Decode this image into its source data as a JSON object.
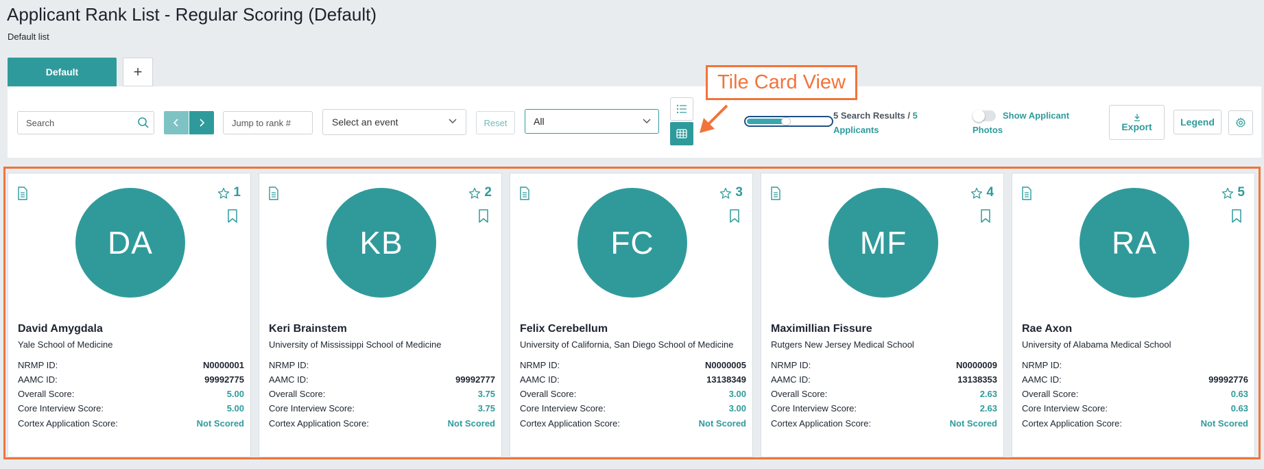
{
  "page": {
    "title": "Applicant Rank List - Regular Scoring (Default)",
    "subtitle": "Default list"
  },
  "tabs": [
    {
      "label": "Default",
      "active": true
    },
    {
      "label": "+",
      "active": false
    }
  ],
  "toolbar": {
    "search_placeholder": "Search",
    "jump_placeholder": "Jump to rank #",
    "event_select": "Select an event",
    "reset_label": "Reset",
    "filter_select": "All",
    "results_count": "5 Search Results /",
    "results_total": "5 Applicants",
    "slider_value": 0.48,
    "show_photos_label": "Show Applicant Photos",
    "show_photos_on": false,
    "export_label": "Export",
    "legend_label": "Legend"
  },
  "annotation": {
    "label": "Tile Card View",
    "color": "#f2733a"
  },
  "colors": {
    "accent": "#2f9a9b",
    "accent_light": "#7ec3c3",
    "annotation": "#f2733a"
  },
  "field_labels": {
    "nrmp": "NRMP ID:",
    "aamc": "AAMC ID:",
    "overall": "Overall Score:",
    "core": "Core Interview Score:",
    "cortex": "Cortex Application Score:"
  },
  "cards": [
    {
      "rank": "1",
      "initials": "DA",
      "name": "David Amygdala",
      "school": "Yale School of Medicine",
      "nrmp": "N0000001",
      "aamc": "99992775",
      "overall": "5.00",
      "core": "5.00",
      "cortex": "Not Scored"
    },
    {
      "rank": "2",
      "initials": "KB",
      "name": "Keri Brainstem",
      "school": "University of Mississippi School of Medicine",
      "nrmp": "",
      "aamc": "99992777",
      "overall": "3.75",
      "core": "3.75",
      "cortex": "Not Scored"
    },
    {
      "rank": "3",
      "initials": "FC",
      "name": "Felix Cerebellum",
      "school": "University of California, San Diego School of Medicine",
      "nrmp": "N0000005",
      "aamc": "13138349",
      "overall": "3.00",
      "core": "3.00",
      "cortex": "Not Scored"
    },
    {
      "rank": "4",
      "initials": "MF",
      "name": "Maximillian Fissure",
      "school": "Rutgers New Jersey Medical School",
      "nrmp": "N0000009",
      "aamc": "13138353",
      "overall": "2.63",
      "core": "2.63",
      "cortex": "Not Scored"
    },
    {
      "rank": "5",
      "initials": "RA",
      "name": "Rae Axon",
      "school": "University of Alabama Medical School",
      "nrmp": "",
      "aamc": "99992776",
      "overall": "0.63",
      "core": "0.63",
      "cortex": "Not Scored"
    }
  ]
}
